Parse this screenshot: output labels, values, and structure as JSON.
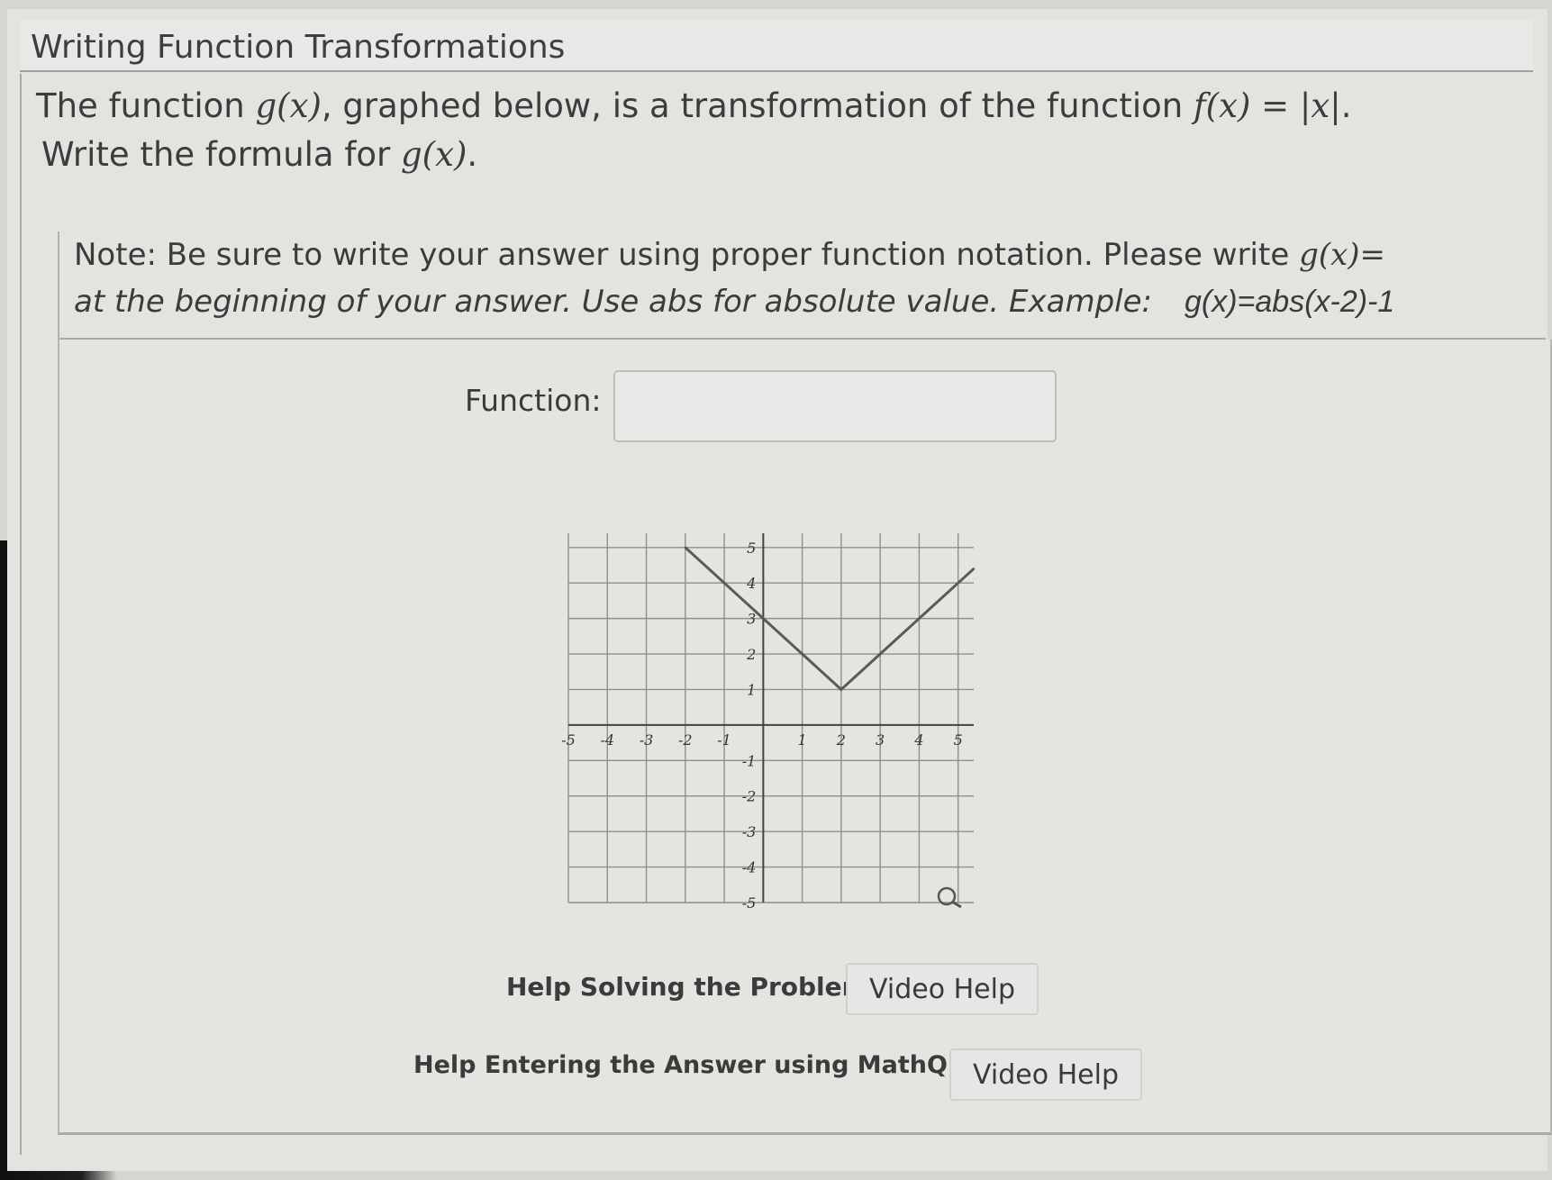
{
  "header": {
    "title": "Writing Function Transformations"
  },
  "question": {
    "line1": {
      "prefix": "The function ",
      "g_of_x": "g(x)",
      "middle": ", graphed below, is a transformation of the function ",
      "f_def": "f(x) = |x|",
      "end": "."
    },
    "line2": {
      "prefix": "Write the formula for ",
      "g_of_x": "g(x)",
      "end": "."
    },
    "note_line1": {
      "text": "Note: Be sure to write your answer using proper function notation.  Please write ",
      "gx": "g(x)="
    },
    "note_line2": {
      "text": "at the beginning of your answer. Use abs for absolute value. Example:",
      "example": "g(x)=abs(x-2)-1"
    }
  },
  "answer": {
    "label": "Function:",
    "value": "",
    "placeholder": ""
  },
  "graph": {
    "x_ticks": [
      "-5",
      "-4",
      "-3",
      "-2",
      "-1",
      "1",
      "2",
      "3",
      "4",
      "5"
    ],
    "y_ticks": [
      "5",
      "4",
      "3",
      "2",
      "1",
      "-1",
      "-2",
      "-3",
      "-4",
      "-5"
    ],
    "magnify_icon": "magnifier-icon"
  },
  "chart_data": {
    "type": "line",
    "xlim": [
      -5,
      5
    ],
    "ylim": [
      -5,
      5
    ],
    "grid": true,
    "series": [
      {
        "x": [
          -2,
          -1,
          0,
          1,
          2,
          3,
          4,
          5,
          5.4
        ],
        "y": [
          5,
          4,
          3,
          2,
          1,
          2,
          3,
          4,
          4.4
        ]
      }
    ]
  },
  "help": {
    "solving_label": "Help Solving the Problem?",
    "solving_button": "Video Help",
    "entering_label": "Help Entering the Answer using MathQuill?",
    "entering_button": "Video Help"
  }
}
